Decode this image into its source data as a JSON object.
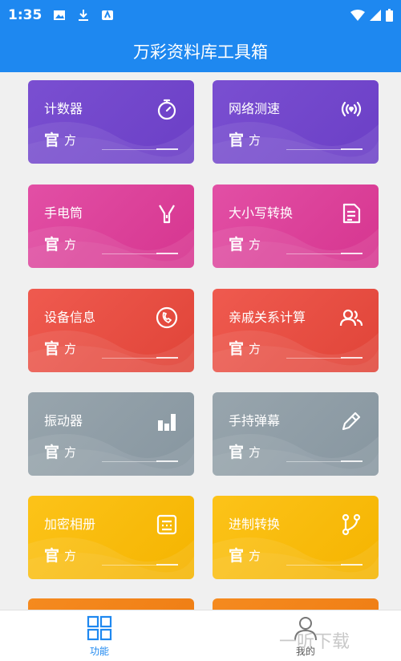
{
  "status_bar": {
    "time": "1:35"
  },
  "header": {
    "title": "万彩资料库工具箱"
  },
  "badge": {
    "main": "官",
    "sub": "方"
  },
  "cards": [
    {
      "title": "计数器",
      "icon": "stopwatch-icon"
    },
    {
      "title": "网络测速",
      "icon": "signal-icon"
    },
    {
      "title": "手电筒",
      "icon": "flashlight-icon"
    },
    {
      "title": "大小写转换",
      "icon": "document-icon"
    },
    {
      "title": "设备信息",
      "icon": "phone-icon"
    },
    {
      "title": "亲戚关系计算",
      "icon": "users-icon"
    },
    {
      "title": "振动器",
      "icon": "bars-icon"
    },
    {
      "title": "手持弹幕",
      "icon": "pencil-icon"
    },
    {
      "title": "加密相册",
      "icon": "calculator-icon"
    },
    {
      "title": "进制转换",
      "icon": "branch-icon"
    }
  ],
  "tabs": [
    {
      "label": "功能",
      "icon": "grid-icon",
      "active": true
    },
    {
      "label": "我的",
      "icon": "user-icon",
      "active": false
    }
  ],
  "watermark": "一听下载",
  "colors": {
    "primary": "#1e88f0",
    "purple": "#6b3fc6",
    "pink": "#d6358f",
    "red": "#e04438",
    "gray": "#8796a0",
    "yellow": "#f5b400",
    "orange": "#ee7b12"
  }
}
